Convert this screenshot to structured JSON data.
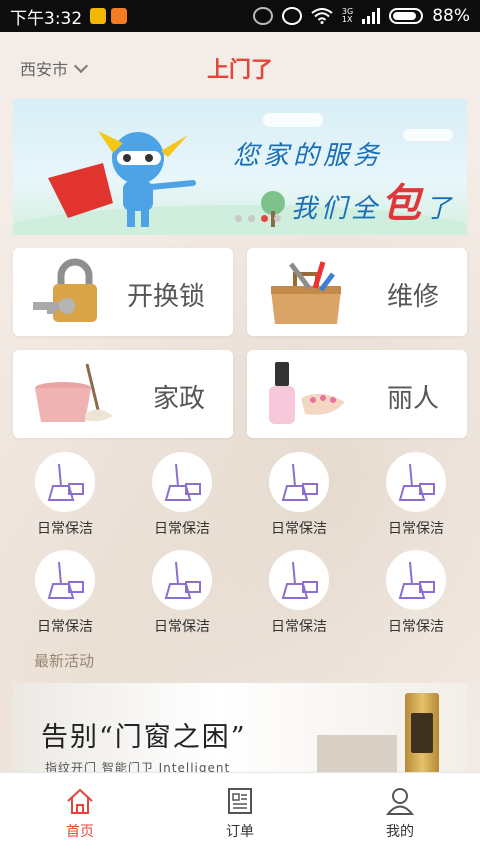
{
  "status_bar": {
    "time": "下午3:32",
    "battery": "88%",
    "network_top": "3G",
    "network_bottom": "1X"
  },
  "header": {
    "city": "西安市",
    "brand": "上门了"
  },
  "banner": {
    "line1": "您家的服务",
    "line2_prefix": "我们全",
    "line2_highlight": "包",
    "line2_suffix": "了",
    "slides": 4,
    "active_slide": 3
  },
  "services": [
    {
      "label": "开换锁",
      "icon": "lock-key-icon"
    },
    {
      "label": "维修",
      "icon": "toolbox-icon"
    },
    {
      "label": "家政",
      "icon": "bucket-mop-icon"
    },
    {
      "label": "丽人",
      "icon": "nail-polish-icon"
    }
  ],
  "categories": [
    {
      "label": "日常保洁"
    },
    {
      "label": "日常保洁"
    },
    {
      "label": "日常保洁"
    },
    {
      "label": "日常保洁"
    },
    {
      "label": "日常保洁"
    },
    {
      "label": "日常保洁"
    },
    {
      "label": "日常保洁"
    },
    {
      "label": "日常保洁"
    }
  ],
  "section_title": "最新活动",
  "promo": {
    "title": "告别“门窗之困”",
    "subtitle": "指纹开门  智能门卫  Intelligent"
  },
  "tabs": [
    {
      "label": "首页",
      "icon": "home-icon",
      "active": true
    },
    {
      "label": "订单",
      "icon": "order-list-icon",
      "active": false
    },
    {
      "label": "我的",
      "icon": "profile-icon",
      "active": false
    }
  ],
  "colors": {
    "accent": "#e4463a",
    "banner_text": "#1a6fb8",
    "category_icon": "#8c6fd1"
  }
}
